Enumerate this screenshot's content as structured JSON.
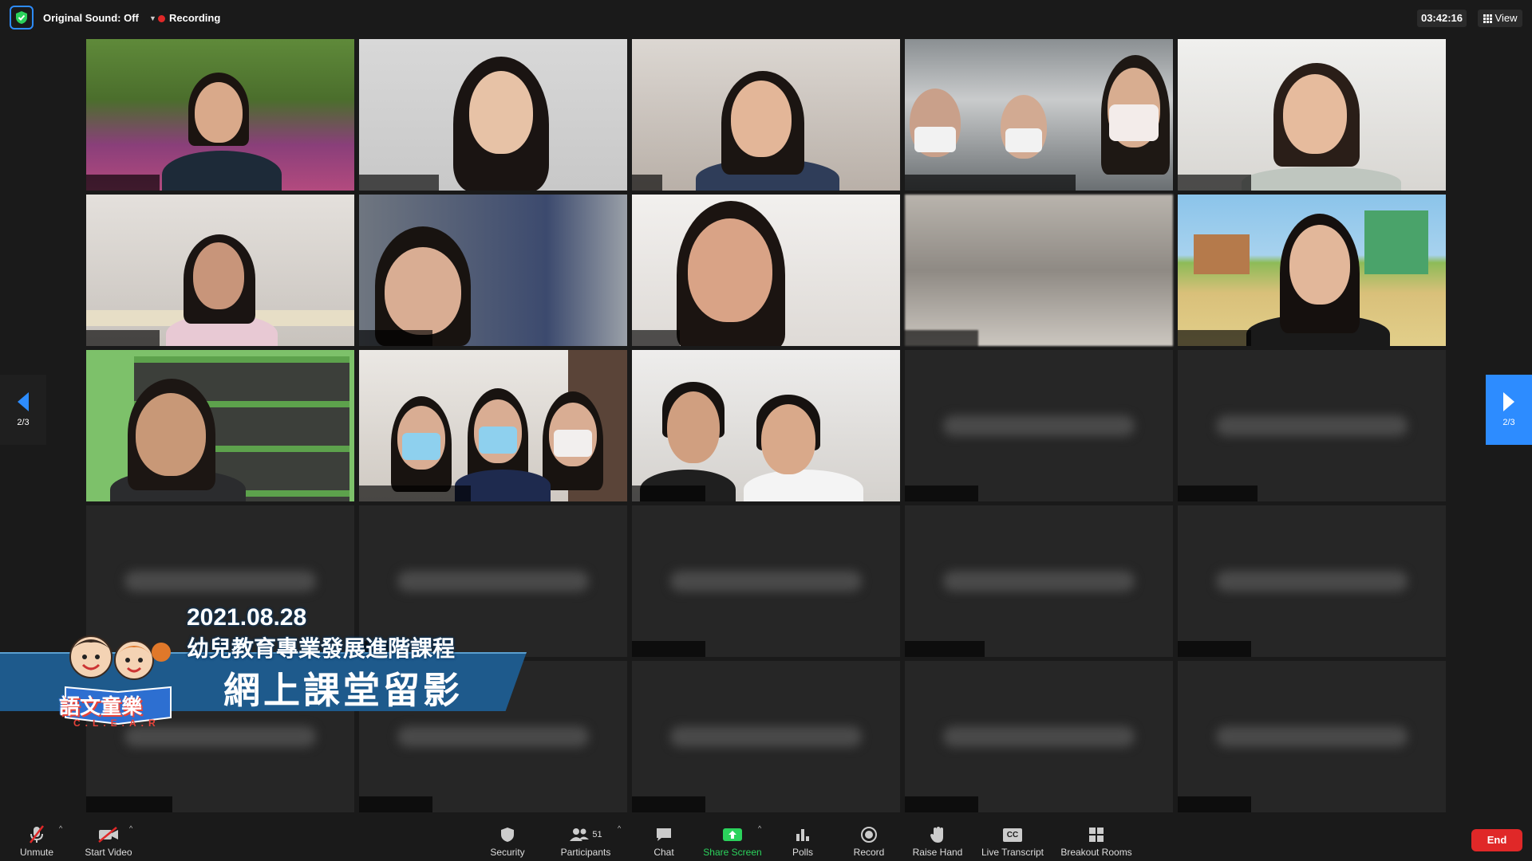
{
  "topbar": {
    "original_sound": "Original Sound: Off",
    "recording": "Recording",
    "timer": "03:42:16",
    "view": "View"
  },
  "pager": {
    "left_label": "2/3",
    "right_label": "2/3"
  },
  "toolbar": {
    "unmute": "Unmute",
    "start_video": "Start Video",
    "security": "Security",
    "participants": "Participants",
    "participants_count": "51",
    "chat": "Chat",
    "share_screen": "Share Screen",
    "polls": "Polls",
    "record": "Record",
    "raise_hand": "Raise Hand",
    "live_transcript": "Live Transcript",
    "live_transcript_icon_text": "CC",
    "breakout_rooms": "Breakout Rooms",
    "end": "End"
  },
  "banner": {
    "date": "2021.08.28",
    "course": "幼兒教育專業發展進階課程",
    "title": "網上課堂留影",
    "logo_text": "語文童樂",
    "logo_sub": "C.L.E.A.R"
  },
  "colors": {
    "accent": "#2d8cff",
    "end_red": "#e02828",
    "share_green": "#2bd25c",
    "banner_blue": "#1e5a8c"
  }
}
